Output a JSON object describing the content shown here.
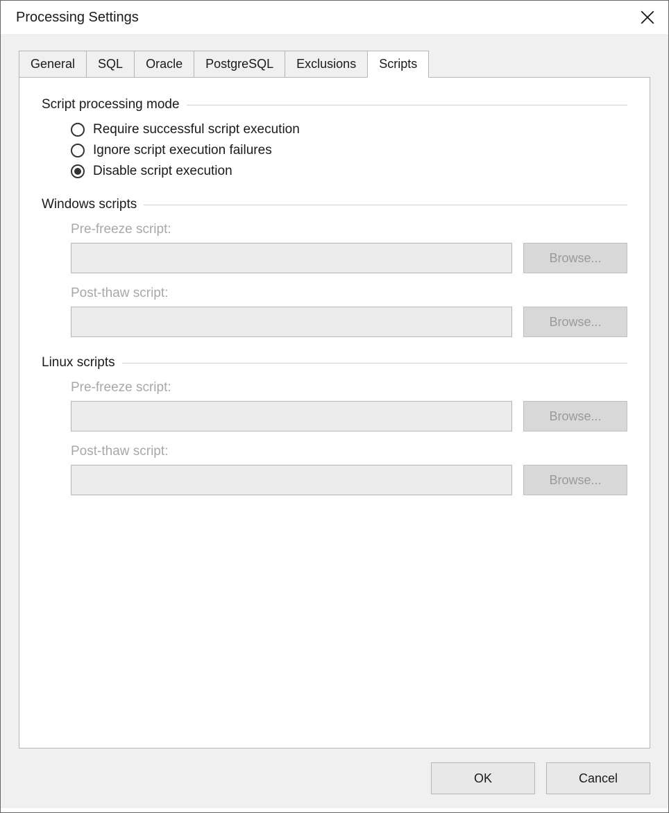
{
  "window": {
    "title": "Processing Settings"
  },
  "tabs": [
    {
      "label": "General",
      "active": false
    },
    {
      "label": "SQL",
      "active": false
    },
    {
      "label": "Oracle",
      "active": false
    },
    {
      "label": "PostgreSQL",
      "active": false
    },
    {
      "label": "Exclusions",
      "active": false
    },
    {
      "label": "Scripts",
      "active": true
    }
  ],
  "groups": {
    "mode": {
      "title": "Script processing mode",
      "options": [
        {
          "label": "Require successful script execution",
          "selected": false
        },
        {
          "label": "Ignore script execution failures",
          "selected": false
        },
        {
          "label": "Disable script execution",
          "selected": true
        }
      ]
    },
    "windows": {
      "title": "Windows scripts",
      "prefreeze_label": "Pre-freeze script:",
      "prefreeze_value": "",
      "postthaw_label": "Post-thaw script:",
      "postthaw_value": "",
      "browse_label": "Browse..."
    },
    "linux": {
      "title": "Linux scripts",
      "prefreeze_label": "Pre-freeze script:",
      "prefreeze_value": "",
      "postthaw_label": "Post-thaw script:",
      "postthaw_value": "",
      "browse_label": "Browse..."
    }
  },
  "footer": {
    "ok": "OK",
    "cancel": "Cancel"
  }
}
